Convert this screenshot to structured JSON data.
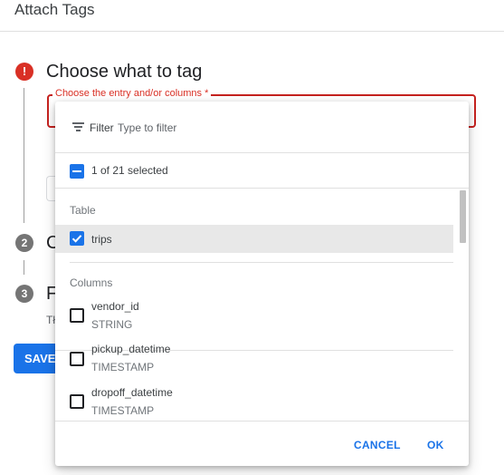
{
  "header": {
    "title": "Attach Tags"
  },
  "steps": [
    {
      "badge": "!",
      "title": "Choose what to tag",
      "state": "error"
    },
    {
      "badge": "2",
      "title": "C"
    },
    {
      "badge": "3",
      "title": "F"
    }
  ],
  "field": {
    "label": "Choose the entry and/or columns *"
  },
  "background": {
    "helper_text": "Tł",
    "save_label": "SAVE"
  },
  "dropdown": {
    "filter": {
      "label": "Filter",
      "placeholder": "Type to filter",
      "value": "",
      "icon": "filter-list-icon"
    },
    "selection_summary": "1 of 21 selected",
    "table_section": {
      "label": "Table",
      "items": [
        {
          "name": "trips",
          "checked": true
        }
      ]
    },
    "columns_section": {
      "label": "Columns",
      "items": [
        {
          "name": "vendor_id",
          "type": "STRING",
          "checked": false
        },
        {
          "name": "pickup_datetime",
          "type": "TIMESTAMP",
          "checked": false
        },
        {
          "name": "dropoff_datetime",
          "type": "TIMESTAMP",
          "checked": false
        }
      ]
    },
    "footer": {
      "cancel_label": "CANCEL",
      "ok_label": "OK"
    }
  },
  "colors": {
    "accent": "#1a73e8",
    "error": "#d93025",
    "highlight": "#e8e8e8"
  }
}
